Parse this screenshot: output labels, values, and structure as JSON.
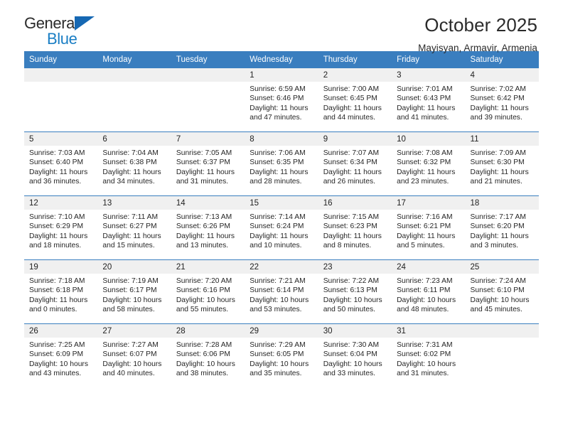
{
  "brand": {
    "name_top": "General",
    "name_bottom": "Blue",
    "triangle_icon": "triangle-icon",
    "accent_color": "#1a7ec4",
    "header_color": "#3a7ebf"
  },
  "header": {
    "title": "October 2025",
    "subtitle": "Mayisyan, Armavir, Armenia"
  },
  "calendar": {
    "weekday_headers": [
      "Sunday",
      "Monday",
      "Tuesday",
      "Wednesday",
      "Thursday",
      "Friday",
      "Saturday"
    ],
    "weeks": [
      [
        {
          "day": "",
          "empty": true,
          "sunrise": "",
          "sunset": "",
          "daylight_line1": "",
          "daylight_line2": ""
        },
        {
          "day": "",
          "empty": true,
          "sunrise": "",
          "sunset": "",
          "daylight_line1": "",
          "daylight_line2": ""
        },
        {
          "day": "",
          "empty": true,
          "sunrise": "",
          "sunset": "",
          "daylight_line1": "",
          "daylight_line2": ""
        },
        {
          "day": "1",
          "empty": false,
          "sunrise": "Sunrise: 6:59 AM",
          "sunset": "Sunset: 6:46 PM",
          "daylight_line1": "Daylight: 11 hours",
          "daylight_line2": "and 47 minutes."
        },
        {
          "day": "2",
          "empty": false,
          "sunrise": "Sunrise: 7:00 AM",
          "sunset": "Sunset: 6:45 PM",
          "daylight_line1": "Daylight: 11 hours",
          "daylight_line2": "and 44 minutes."
        },
        {
          "day": "3",
          "empty": false,
          "sunrise": "Sunrise: 7:01 AM",
          "sunset": "Sunset: 6:43 PM",
          "daylight_line1": "Daylight: 11 hours",
          "daylight_line2": "and 41 minutes."
        },
        {
          "day": "4",
          "empty": false,
          "sunrise": "Sunrise: 7:02 AM",
          "sunset": "Sunset: 6:42 PM",
          "daylight_line1": "Daylight: 11 hours",
          "daylight_line2": "and 39 minutes."
        }
      ],
      [
        {
          "day": "5",
          "empty": false,
          "sunrise": "Sunrise: 7:03 AM",
          "sunset": "Sunset: 6:40 PM",
          "daylight_line1": "Daylight: 11 hours",
          "daylight_line2": "and 36 minutes."
        },
        {
          "day": "6",
          "empty": false,
          "sunrise": "Sunrise: 7:04 AM",
          "sunset": "Sunset: 6:38 PM",
          "daylight_line1": "Daylight: 11 hours",
          "daylight_line2": "and 34 minutes."
        },
        {
          "day": "7",
          "empty": false,
          "sunrise": "Sunrise: 7:05 AM",
          "sunset": "Sunset: 6:37 PM",
          "daylight_line1": "Daylight: 11 hours",
          "daylight_line2": "and 31 minutes."
        },
        {
          "day": "8",
          "empty": false,
          "sunrise": "Sunrise: 7:06 AM",
          "sunset": "Sunset: 6:35 PM",
          "daylight_line1": "Daylight: 11 hours",
          "daylight_line2": "and 28 minutes."
        },
        {
          "day": "9",
          "empty": false,
          "sunrise": "Sunrise: 7:07 AM",
          "sunset": "Sunset: 6:34 PM",
          "daylight_line1": "Daylight: 11 hours",
          "daylight_line2": "and 26 minutes."
        },
        {
          "day": "10",
          "empty": false,
          "sunrise": "Sunrise: 7:08 AM",
          "sunset": "Sunset: 6:32 PM",
          "daylight_line1": "Daylight: 11 hours",
          "daylight_line2": "and 23 minutes."
        },
        {
          "day": "11",
          "empty": false,
          "sunrise": "Sunrise: 7:09 AM",
          "sunset": "Sunset: 6:30 PM",
          "daylight_line1": "Daylight: 11 hours",
          "daylight_line2": "and 21 minutes."
        }
      ],
      [
        {
          "day": "12",
          "empty": false,
          "sunrise": "Sunrise: 7:10 AM",
          "sunset": "Sunset: 6:29 PM",
          "daylight_line1": "Daylight: 11 hours",
          "daylight_line2": "and 18 minutes."
        },
        {
          "day": "13",
          "empty": false,
          "sunrise": "Sunrise: 7:11 AM",
          "sunset": "Sunset: 6:27 PM",
          "daylight_line1": "Daylight: 11 hours",
          "daylight_line2": "and 15 minutes."
        },
        {
          "day": "14",
          "empty": false,
          "sunrise": "Sunrise: 7:13 AM",
          "sunset": "Sunset: 6:26 PM",
          "daylight_line1": "Daylight: 11 hours",
          "daylight_line2": "and 13 minutes."
        },
        {
          "day": "15",
          "empty": false,
          "sunrise": "Sunrise: 7:14 AM",
          "sunset": "Sunset: 6:24 PM",
          "daylight_line1": "Daylight: 11 hours",
          "daylight_line2": "and 10 minutes."
        },
        {
          "day": "16",
          "empty": false,
          "sunrise": "Sunrise: 7:15 AM",
          "sunset": "Sunset: 6:23 PM",
          "daylight_line1": "Daylight: 11 hours",
          "daylight_line2": "and 8 minutes."
        },
        {
          "day": "17",
          "empty": false,
          "sunrise": "Sunrise: 7:16 AM",
          "sunset": "Sunset: 6:21 PM",
          "daylight_line1": "Daylight: 11 hours",
          "daylight_line2": "and 5 minutes."
        },
        {
          "day": "18",
          "empty": false,
          "sunrise": "Sunrise: 7:17 AM",
          "sunset": "Sunset: 6:20 PM",
          "daylight_line1": "Daylight: 11 hours",
          "daylight_line2": "and 3 minutes."
        }
      ],
      [
        {
          "day": "19",
          "empty": false,
          "sunrise": "Sunrise: 7:18 AM",
          "sunset": "Sunset: 6:18 PM",
          "daylight_line1": "Daylight: 11 hours",
          "daylight_line2": "and 0 minutes."
        },
        {
          "day": "20",
          "empty": false,
          "sunrise": "Sunrise: 7:19 AM",
          "sunset": "Sunset: 6:17 PM",
          "daylight_line1": "Daylight: 10 hours",
          "daylight_line2": "and 58 minutes."
        },
        {
          "day": "21",
          "empty": false,
          "sunrise": "Sunrise: 7:20 AM",
          "sunset": "Sunset: 6:16 PM",
          "daylight_line1": "Daylight: 10 hours",
          "daylight_line2": "and 55 minutes."
        },
        {
          "day": "22",
          "empty": false,
          "sunrise": "Sunrise: 7:21 AM",
          "sunset": "Sunset: 6:14 PM",
          "daylight_line1": "Daylight: 10 hours",
          "daylight_line2": "and 53 minutes."
        },
        {
          "day": "23",
          "empty": false,
          "sunrise": "Sunrise: 7:22 AM",
          "sunset": "Sunset: 6:13 PM",
          "daylight_line1": "Daylight: 10 hours",
          "daylight_line2": "and 50 minutes."
        },
        {
          "day": "24",
          "empty": false,
          "sunrise": "Sunrise: 7:23 AM",
          "sunset": "Sunset: 6:11 PM",
          "daylight_line1": "Daylight: 10 hours",
          "daylight_line2": "and 48 minutes."
        },
        {
          "day": "25",
          "empty": false,
          "sunrise": "Sunrise: 7:24 AM",
          "sunset": "Sunset: 6:10 PM",
          "daylight_line1": "Daylight: 10 hours",
          "daylight_line2": "and 45 minutes."
        }
      ],
      [
        {
          "day": "26",
          "empty": false,
          "sunrise": "Sunrise: 7:25 AM",
          "sunset": "Sunset: 6:09 PM",
          "daylight_line1": "Daylight: 10 hours",
          "daylight_line2": "and 43 minutes."
        },
        {
          "day": "27",
          "empty": false,
          "sunrise": "Sunrise: 7:27 AM",
          "sunset": "Sunset: 6:07 PM",
          "daylight_line1": "Daylight: 10 hours",
          "daylight_line2": "and 40 minutes."
        },
        {
          "day": "28",
          "empty": false,
          "sunrise": "Sunrise: 7:28 AM",
          "sunset": "Sunset: 6:06 PM",
          "daylight_line1": "Daylight: 10 hours",
          "daylight_line2": "and 38 minutes."
        },
        {
          "day": "29",
          "empty": false,
          "sunrise": "Sunrise: 7:29 AM",
          "sunset": "Sunset: 6:05 PM",
          "daylight_line1": "Daylight: 10 hours",
          "daylight_line2": "and 35 minutes."
        },
        {
          "day": "30",
          "empty": false,
          "sunrise": "Sunrise: 7:30 AM",
          "sunset": "Sunset: 6:04 PM",
          "daylight_line1": "Daylight: 10 hours",
          "daylight_line2": "and 33 minutes."
        },
        {
          "day": "31",
          "empty": false,
          "sunrise": "Sunrise: 7:31 AM",
          "sunset": "Sunset: 6:02 PM",
          "daylight_line1": "Daylight: 10 hours",
          "daylight_line2": "and 31 minutes."
        },
        {
          "day": "",
          "empty": true,
          "sunrise": "",
          "sunset": "",
          "daylight_line1": "",
          "daylight_line2": ""
        }
      ]
    ]
  }
}
